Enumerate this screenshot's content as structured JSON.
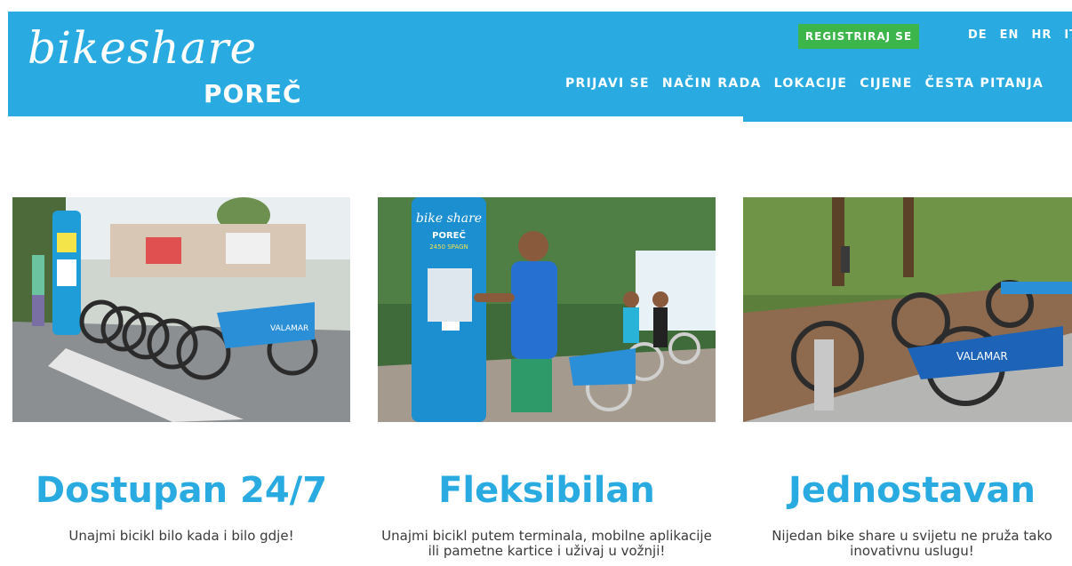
{
  "header": {
    "logo_script": "bikeshare",
    "logo_city": "POREČ",
    "register_label": "REGISTRIRAJ SE",
    "languages": [
      "DE",
      "EN",
      "HR",
      "IT"
    ],
    "nav": [
      "PRIJAVI SE",
      "NAČIN RADA",
      "LOKACIJE",
      "CIJENE",
      "ČESTA PITANJA"
    ],
    "terminal_logo": "bike share",
    "terminal_city": "POREČ",
    "terminal_stations": "2450 SPAGN"
  },
  "colors": {
    "brand_blue": "#29abe2",
    "register_green": "#3cb54a",
    "body_text": "#3a3a3a"
  },
  "features": [
    {
      "title": "Dostupan 24/7",
      "text": "Unajmi bicikl bilo kada i bilo gdje!"
    },
    {
      "title": "Fleksibilan",
      "text": "Unajmi bicikl putem terminala, mobilne aplikacije ili pametne kartice i uživaj u vožnji!"
    },
    {
      "title": "Jednostavan",
      "text": "Nijedan bike share u svijetu ne pruža tako inovativnu uslugu!"
    }
  ],
  "bike_brand": "VALAMAR"
}
